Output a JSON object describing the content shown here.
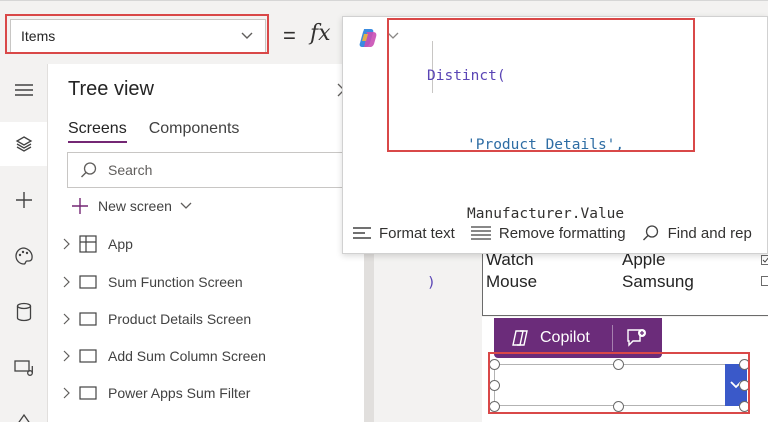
{
  "formula_bar": {
    "property": "Items",
    "equals": "=",
    "fx": "fx",
    "code_lines": [
      "Distinct(",
      "'Product Details',",
      "Manufacturer.Value",
      ")"
    ],
    "toolbar": [
      {
        "label": "Format text",
        "icon": "format-text-icon"
      },
      {
        "label": "Remove formatting",
        "icon": "remove-formatting-icon"
      },
      {
        "label": "Find and rep",
        "icon": "find-replace-icon"
      }
    ]
  },
  "tree_view": {
    "title": "Tree view",
    "tabs": [
      "Screens",
      "Components"
    ],
    "search_placeholder": "Search",
    "new_screen": "New screen",
    "items": [
      {
        "label": "App",
        "icon": "app-icon"
      },
      {
        "label": "Sum Function Screen",
        "icon": "screen-icon"
      },
      {
        "label": "Product Details Screen",
        "icon": "screen-icon"
      },
      {
        "label": "Add Sum Column Screen",
        "icon": "screen-icon"
      },
      {
        "label": "Power Apps Sum Filter",
        "icon": "screen-icon"
      }
    ]
  },
  "canvas": {
    "gallery_rows": [
      {
        "product": "Watch",
        "manufacturer": "Apple",
        "checked": true
      },
      {
        "product": "Mouse",
        "manufacturer": "Samsung",
        "checked": false
      }
    ],
    "copilot_label": "Copilot"
  },
  "colors": {
    "highlight": "#d94848",
    "brand_purple": "#742774",
    "copilot_bg": "#6b2c7a",
    "dropdown_accent": "#3a59c9"
  }
}
